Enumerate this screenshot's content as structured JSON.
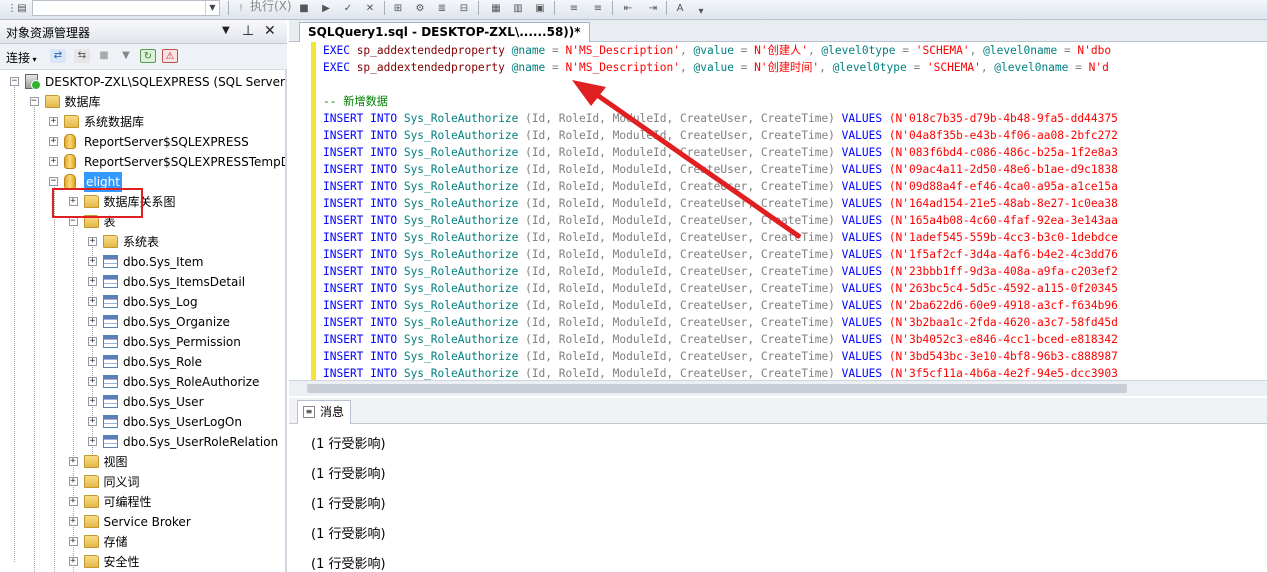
{
  "toolbar": {
    "execute_label": "执行(X)"
  },
  "object_explorer": {
    "title": "对象资源管理器",
    "pin_glyph": "▾ 📌",
    "close_glyph": "✕",
    "connect_label": "连接",
    "tree": [
      {
        "label": "DESKTOP-ZXL\\SQLEXPRESS (SQL Server 1",
        "level": 0,
        "icon": "server-icon",
        "expander": "−"
      },
      {
        "label": "数据库",
        "level": 1,
        "icon": "folder-icon",
        "expander": "−"
      },
      {
        "label": "系统数据库",
        "level": 2,
        "icon": "folder-icon",
        "expander": "+"
      },
      {
        "label": "ReportServer$SQLEXPRESS",
        "level": 2,
        "icon": "database-icon",
        "expander": "+"
      },
      {
        "label": "ReportServer$SQLEXPRESSTempD",
        "level": 2,
        "icon": "database-icon",
        "expander": "+"
      },
      {
        "label": "elight",
        "level": 2,
        "icon": "database-icon",
        "expander": "−",
        "selected": true
      },
      {
        "label": "数据库关系图",
        "level": 3,
        "icon": "folder-icon",
        "expander": "+"
      },
      {
        "label": "表",
        "level": 3,
        "icon": "folder-icon",
        "expander": "−"
      },
      {
        "label": "系统表",
        "level": 4,
        "icon": "folder-icon",
        "expander": "+"
      },
      {
        "label": "dbo.Sys_Item",
        "level": 4,
        "icon": "table-icon",
        "expander": "+"
      },
      {
        "label": "dbo.Sys_ItemsDetail",
        "level": 4,
        "icon": "table-icon",
        "expander": "+"
      },
      {
        "label": "dbo.Sys_Log",
        "level": 4,
        "icon": "table-icon",
        "expander": "+"
      },
      {
        "label": "dbo.Sys_Organize",
        "level": 4,
        "icon": "table-icon",
        "expander": "+"
      },
      {
        "label": "dbo.Sys_Permission",
        "level": 4,
        "icon": "table-icon",
        "expander": "+"
      },
      {
        "label": "dbo.Sys_Role",
        "level": 4,
        "icon": "table-icon",
        "expander": "+"
      },
      {
        "label": "dbo.Sys_RoleAuthorize",
        "level": 4,
        "icon": "table-icon",
        "expander": "+"
      },
      {
        "label": "dbo.Sys_User",
        "level": 4,
        "icon": "table-icon",
        "expander": "+"
      },
      {
        "label": "dbo.Sys_UserLogOn",
        "level": 4,
        "icon": "table-icon",
        "expander": "+"
      },
      {
        "label": "dbo.Sys_UserRoleRelation",
        "level": 4,
        "icon": "table-icon",
        "expander": "+"
      },
      {
        "label": "视图",
        "level": 3,
        "icon": "folder-icon",
        "expander": "+"
      },
      {
        "label": "同义词",
        "level": 3,
        "icon": "folder-icon",
        "expander": "+"
      },
      {
        "label": "可编程性",
        "level": 3,
        "icon": "folder-icon",
        "expander": "+"
      },
      {
        "label": "Service Broker",
        "level": 3,
        "icon": "folder-icon",
        "expander": "+"
      },
      {
        "label": "存储",
        "level": 3,
        "icon": "folder-icon",
        "expander": "+"
      },
      {
        "label": "安全性",
        "level": 3,
        "icon": "folder-icon",
        "expander": "+"
      }
    ]
  },
  "editor": {
    "tab_title": "SQLQuery1.sql - DESKTOP-ZXL\\......58))*",
    "lines": [
      [
        {
          "t": "EXEC ",
          "c": "kw"
        },
        {
          "t": "sp_addextendedproperty ",
          "c": "fn"
        },
        {
          "t": "@name",
          "c": "var"
        },
        {
          "t": " = ",
          "c": "gry"
        },
        {
          "t": "N'MS_Description'",
          "c": "str"
        },
        {
          "t": ", ",
          "c": "gry"
        },
        {
          "t": "@value",
          "c": "var"
        },
        {
          "t": " = ",
          "c": "gry"
        },
        {
          "t": "N'创建人'",
          "c": "str"
        },
        {
          "t": ", ",
          "c": "gry"
        },
        {
          "t": "@level0type",
          "c": "var"
        },
        {
          "t": " = ",
          "c": "gry"
        },
        {
          "t": "'SCHEMA'",
          "c": "str"
        },
        {
          "t": ", ",
          "c": "gry"
        },
        {
          "t": "@level0name",
          "c": "var"
        },
        {
          "t": " = ",
          "c": "gry"
        },
        {
          "t": "N'dbo",
          "c": "str"
        }
      ],
      [
        {
          "t": "EXEC ",
          "c": "kw"
        },
        {
          "t": "sp_addextendedproperty ",
          "c": "fn"
        },
        {
          "t": "@name",
          "c": "var"
        },
        {
          "t": " = ",
          "c": "gry"
        },
        {
          "t": "N'MS_Description'",
          "c": "str"
        },
        {
          "t": ", ",
          "c": "gry"
        },
        {
          "t": "@value",
          "c": "var"
        },
        {
          "t": " = ",
          "c": "gry"
        },
        {
          "t": "N'创建时间'",
          "c": "str"
        },
        {
          "t": ", ",
          "c": "gry"
        },
        {
          "t": "@level0type",
          "c": "var"
        },
        {
          "t": " = ",
          "c": "gry"
        },
        {
          "t": "'SCHEMA'",
          "c": "str"
        },
        {
          "t": ", ",
          "c": "gry"
        },
        {
          "t": "@level0name",
          "c": "var"
        },
        {
          "t": " = ",
          "c": "gry"
        },
        {
          "t": "N'd",
          "c": "str"
        }
      ],
      [],
      [
        {
          "t": "-- 新增数据",
          "c": "cmt"
        }
      ]
    ],
    "insert_prefix": "INSERT INTO ",
    "insert_table": "Sys_RoleAuthorize ",
    "insert_cols": "(Id, RoleId, ModuleId, CreateUser, CreateTime) ",
    "insert_values_kw": "VALUES ",
    "insert_values": [
      "(N'018c7b35-d79b-4b48-9fa5-dd44375",
      "(N'04a8f35b-e43b-4f06-aa08-2bfc272",
      "(N'083f6bd4-c086-486c-b25a-1f2e8a3",
      "(N'09ac4a11-2d50-48e6-b1ae-d9c1838",
      "(N'09d88a4f-ef46-4ca0-a95a-a1ce15a",
      "(N'164ad154-21e5-48ab-8e27-1c0ea38",
      "(N'165a4b08-4c60-4faf-92ea-3e143aa",
      "(N'1adef545-559b-4cc3-b3c0-1debdce",
      "(N'1f5af2cf-3d4a-4af6-b4e2-4c3dd76",
      "(N'23bbb1ff-9d3a-408a-a9fa-c203ef2",
      "(N'263bc5c4-5d5c-4592-a115-0f20345",
      "(N'2ba622d6-60e9-4918-a3cf-f634b96",
      "(N'3b2baa1c-2fda-4620-a3c7-58fd45d",
      "(N'3b4052c3-e846-4cc1-bced-e818342",
      "(N'3bd543bc-3e10-4bf8-96b3-c888987",
      "(N'3f5cf11a-4b6a-4e2f-94e5-dcc3903"
    ]
  },
  "results": {
    "tab_label": "消息",
    "messages": [
      "(1 行受影响)",
      "(1 行受影响)",
      "(1 行受影响)",
      "(1 行受影响)",
      "(1 行受影响)"
    ]
  },
  "annotation": {
    "arrow_color": "#e02020",
    "box_color": "#e02020"
  }
}
